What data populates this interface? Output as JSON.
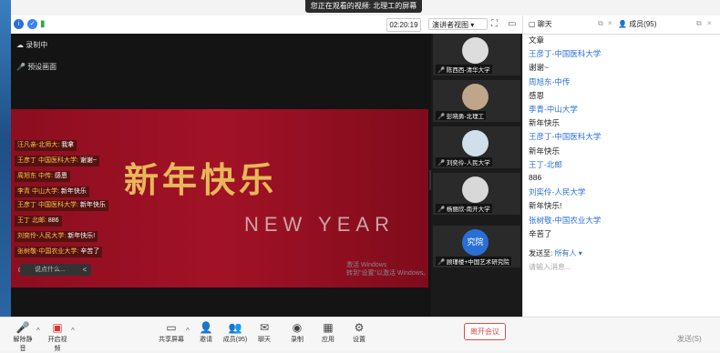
{
  "banner": "您正在观看的视频: 北理工的屏幕",
  "topbar": {
    "timer": "02:20:19",
    "view_label": "演讲者视图"
  },
  "main": {
    "recording_label": "录制中",
    "mic_label": "预设画面",
    "video_title": "新年快乐",
    "video_subtitle": "NEW YEAR",
    "watermark": "激活 Windows\n转到\"设置\"以激活 Windows。",
    "danmaku": [
      {
        "name": "汪凡亲-北师大:",
        "text": "我拿"
      },
      {
        "name": "王彦丁 中国医科大学:",
        "text": "谢谢~"
      },
      {
        "name": "周旭东 中传:",
        "text": "感恩"
      },
      {
        "name": "李青 中山大学:",
        "text": "新年快乐"
      },
      {
        "name": "王彦丁 中国医科大学:",
        "text": "新年快乐"
      },
      {
        "name": "王丁 北邮:",
        "text": "886"
      },
      {
        "name": "刘奕伶-人民大学:",
        "text": "新年快乐!"
      },
      {
        "name": "张树敬-中国农业大学:",
        "text": "辛苦了"
      }
    ],
    "input_placeholder": "说点什么...",
    "input_arrow": "<"
  },
  "participants": [
    {
      "name": "陈西西-清华大学"
    },
    {
      "name": "彭晓勇-北理工"
    },
    {
      "name": "刘奕伶-人民大学"
    },
    {
      "name": "杨丽欣-南开大学"
    },
    {
      "name": "顾瑾楼+中国艺术研究院",
      "avatar_text": "究院"
    }
  ],
  "chat": {
    "tab_chat": "聊天",
    "tab_members": "成员(95)",
    "messages": [
      {
        "type": "text",
        "text": "文章"
      },
      {
        "type": "name",
        "text": "王彦丁-中国医科大学"
      },
      {
        "type": "text",
        "text": "谢谢~"
      },
      {
        "type": "name",
        "text": "周旭东-中传"
      },
      {
        "type": "text",
        "text": "感恩"
      },
      {
        "type": "name",
        "text": "李青-中山大学"
      },
      {
        "type": "text",
        "text": "新年快乐"
      },
      {
        "type": "name",
        "text": "王彦丁-中国医科大学"
      },
      {
        "type": "text",
        "text": "新年快乐"
      },
      {
        "type": "name",
        "text": "王丁-北邮"
      },
      {
        "type": "text",
        "text": "886"
      },
      {
        "type": "name",
        "text": "刘奕伶-人民大学"
      },
      {
        "type": "text",
        "text": "新年快乐!"
      },
      {
        "type": "name",
        "text": "张树敬-中国农业大学"
      },
      {
        "type": "text",
        "text": "辛苦了"
      }
    ],
    "send_to_label": "发送至:",
    "send_to_value": "所有人",
    "input_placeholder": "请输入消息..."
  },
  "toolbar": {
    "mic": "解除静音",
    "video": "开启视频",
    "share": "共享屏幕",
    "invite": "邀请",
    "members": "成员(95)",
    "chat": "聊天",
    "record": "录制",
    "apps": "应用",
    "settings": "设置",
    "end": "离开会议",
    "send": "发送(S)"
  },
  "colors": {
    "accent": "#2a6fd6",
    "end": "#e24a4a",
    "banner_red": "#a21226"
  }
}
